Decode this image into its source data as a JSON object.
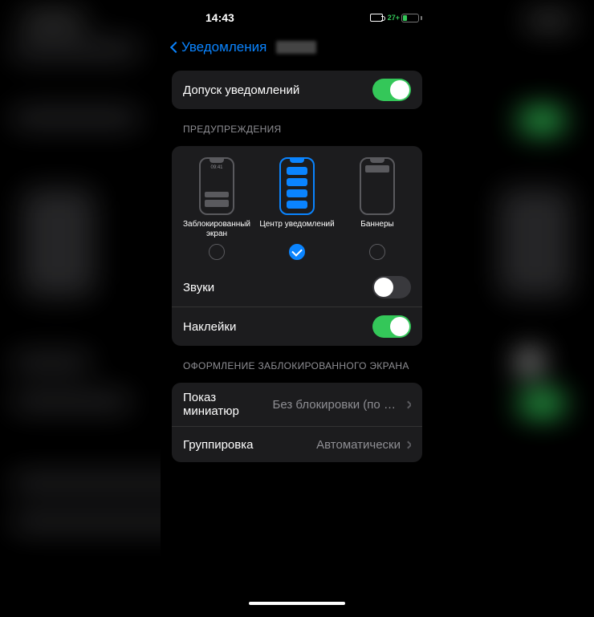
{
  "status": {
    "time": "14:43",
    "battery_text": "27+"
  },
  "nav": {
    "back": "Уведомления"
  },
  "allow": {
    "label": "Допуск уведомлений",
    "on": true
  },
  "alerts_header": "ПРЕДУПРЕЖДЕНИЯ",
  "alerts": {
    "lock": {
      "label": "Заблокированный экран",
      "time": "09:41",
      "selected": false
    },
    "center": {
      "label": "Центр уведомлений",
      "selected": true
    },
    "banner": {
      "label": "Баннеры",
      "selected": false
    }
  },
  "sounds": {
    "label": "Звуки",
    "on": false
  },
  "stickers": {
    "label": "Наклейки",
    "on": true
  },
  "lockscreen_header": "ОФОРМЛЕНИЕ ЗАБЛОКИРОВАННОГО ЭКРАНА",
  "previews": {
    "label": "Показ миниатюр",
    "value": "Без блокировки (по ум…"
  },
  "grouping": {
    "label": "Группировка",
    "value": "Автоматически"
  }
}
